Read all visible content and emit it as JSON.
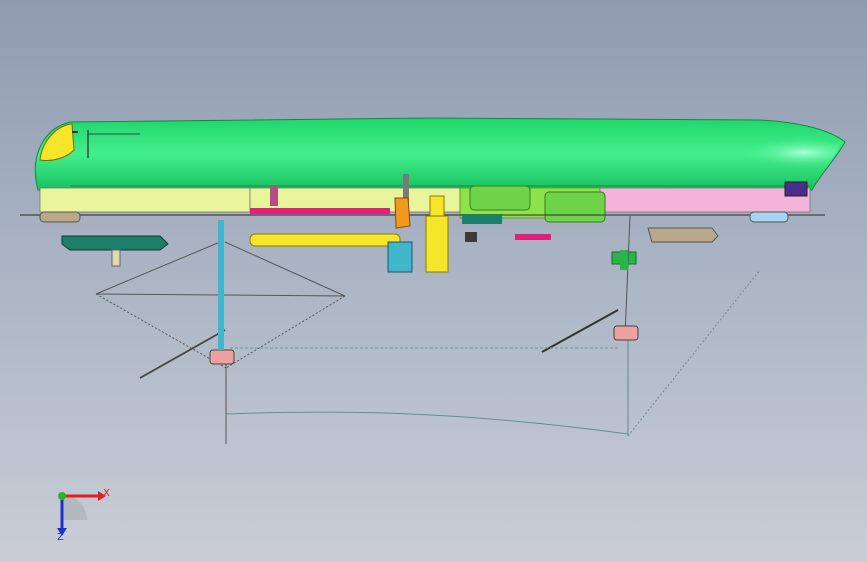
{
  "viewport": {
    "background_top": "#8f9bb0",
    "background_bottom": "#c9ced6"
  },
  "model": {
    "hull_color": "#2ce57a",
    "deck_color": "#e8f59a",
    "accent_pink": "#f4b3d8",
    "accent_magenta": "#e0207a",
    "accent_yellow": "#f5e62a",
    "accent_orange": "#f29a1e",
    "accent_teal": "#1d7f6b",
    "accent_cyan": "#3fb6c9"
  },
  "triad": {
    "x_label": "X",
    "z_label": "Z",
    "x_color": "#e02020",
    "y_color": "#2ab52a",
    "z_color": "#2030d0"
  }
}
